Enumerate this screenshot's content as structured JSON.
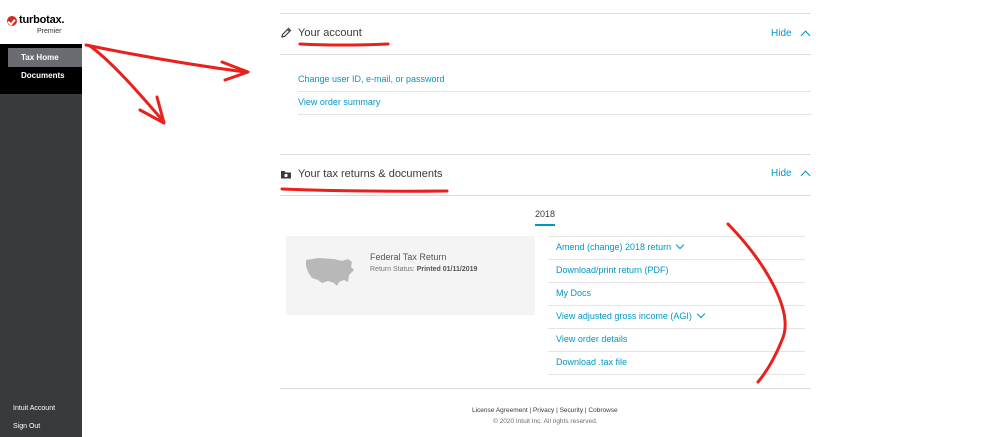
{
  "sidebar": {
    "brand_name": "turbotax.",
    "brand_edition": "Premier",
    "nav_items": [
      {
        "label": "Tax Home",
        "active": true
      },
      {
        "label": "Documents",
        "active": false
      }
    ],
    "bottom_items": [
      {
        "label": "Intuit Account"
      },
      {
        "label": "Sign Out"
      }
    ]
  },
  "account_section": {
    "title": "Your account",
    "icon": "pencil-icon",
    "hide_label": "Hide",
    "links": [
      {
        "label": "Change user ID, e-mail, or password"
      },
      {
        "label": "View order summary"
      }
    ]
  },
  "returns_section": {
    "title": "Your tax returns & documents",
    "icon": "folder-icon",
    "hide_label": "Hide",
    "year_tab": "2018",
    "card": {
      "title": "Federal Tax Return",
      "status_label": "Return Status:",
      "status_value": "Printed 01/11/2019"
    },
    "actions": [
      {
        "label": "Amend (change) 2018 return",
        "has_dropdown": true
      },
      {
        "label": "Download/print return (PDF)",
        "has_dropdown": false
      },
      {
        "label": "My Docs",
        "has_dropdown": false
      },
      {
        "label": "View adjusted gross income (AGI)",
        "has_dropdown": true
      },
      {
        "label": "View order details",
        "has_dropdown": false
      },
      {
        "label": "Download .tax file",
        "has_dropdown": false
      }
    ]
  },
  "footer": {
    "links": [
      "License Agreement",
      "Privacy",
      "Security",
      "Cobrowse"
    ],
    "separator": " | ",
    "copyright": "© 2020 Intuit Inc. All rights reserved."
  },
  "colors": {
    "accent": "#0097c4",
    "sidebar_bg": "#393a3d",
    "brand_red": "#d52b1e",
    "annotation_red": "#e8211c"
  }
}
